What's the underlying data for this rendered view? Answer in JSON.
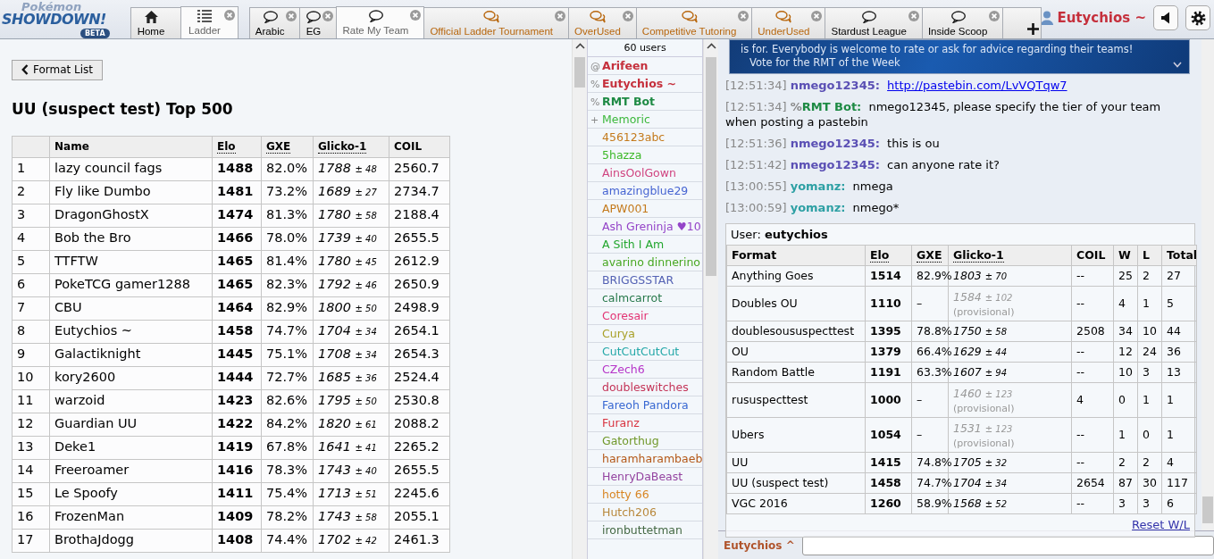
{
  "logo": {
    "top": "Pokémon",
    "main": "SHOWDOWN!",
    "badge": "BETA"
  },
  "page_tabs": [
    {
      "label": "Home",
      "kind": "home",
      "selected": false,
      "closable": false
    },
    {
      "label": "Ladder",
      "kind": "ladder",
      "selected": true,
      "closable": true
    }
  ],
  "room_tabs": [
    {
      "label": "Arabic",
      "official": false,
      "selected": false
    },
    {
      "label": "EG",
      "official": false,
      "selected": false
    },
    {
      "label": "Rate My Team",
      "official": false,
      "selected": true
    },
    {
      "label": "Official Ladder Tournament",
      "official": true,
      "selected": false
    },
    {
      "label": "OverUsed",
      "official": true,
      "selected": false
    },
    {
      "label": "Competitive Tutoring",
      "official": true,
      "selected": false
    },
    {
      "label": "UnderUsed",
      "official": true,
      "selected": false
    },
    {
      "label": "Stardust League",
      "official": false,
      "selected": false
    },
    {
      "label": "Inside Scoop",
      "official": false,
      "selected": false
    }
  ],
  "account": {
    "name": "Eutychios ~"
  },
  "ladder": {
    "back_button": "Format List",
    "title": "UU (suspect test) Top 500",
    "columns": [
      "Name",
      "Elo",
      "GXE",
      "Glicko-1",
      "COIL"
    ],
    "rows": [
      {
        "rank": "1",
        "name": "lazy council fags",
        "elo": "1488",
        "gxe": "82.0%",
        "glicko": "1788",
        "deviation": "± 48",
        "coil": "2560.7"
      },
      {
        "rank": "2",
        "name": "Fly like Dumbo",
        "elo": "1481",
        "gxe": "73.2%",
        "glicko": "1689",
        "deviation": "± 27",
        "coil": "2734.7"
      },
      {
        "rank": "3",
        "name": "DragonGhostX",
        "elo": "1474",
        "gxe": "81.3%",
        "glicko": "1780",
        "deviation": "± 58",
        "coil": "2188.4"
      },
      {
        "rank": "4",
        "name": "Bob the Bro",
        "elo": "1466",
        "gxe": "78.0%",
        "glicko": "1739",
        "deviation": "± 40",
        "coil": "2655.5"
      },
      {
        "rank": "5",
        "name": "TTFTW",
        "elo": "1465",
        "gxe": "81.4%",
        "glicko": "1780",
        "deviation": "± 45",
        "coil": "2612.9"
      },
      {
        "rank": "6",
        "name": "PokeTCG gamer1288",
        "elo": "1465",
        "gxe": "82.3%",
        "glicko": "1792",
        "deviation": "± 46",
        "coil": "2650.9"
      },
      {
        "rank": "7",
        "name": "CBU",
        "elo": "1464",
        "gxe": "82.9%",
        "glicko": "1800",
        "deviation": "± 50",
        "coil": "2498.9"
      },
      {
        "rank": "8",
        "name": "Eutychios ~",
        "elo": "1458",
        "gxe": "74.7%",
        "glicko": "1704",
        "deviation": "± 34",
        "coil": "2654.1"
      },
      {
        "rank": "9",
        "name": "Galactiknight",
        "elo": "1445",
        "gxe": "75.1%",
        "glicko": "1708",
        "deviation": "± 34",
        "coil": "2654.3"
      },
      {
        "rank": "10",
        "name": "kory2600",
        "elo": "1444",
        "gxe": "72.7%",
        "glicko": "1685",
        "deviation": "± 36",
        "coil": "2524.4"
      },
      {
        "rank": "11",
        "name": "warzoid",
        "elo": "1423",
        "gxe": "82.6%",
        "glicko": "1795",
        "deviation": "± 50",
        "coil": "2530.8"
      },
      {
        "rank": "12",
        "name": "Guardian UU",
        "elo": "1422",
        "gxe": "84.2%",
        "glicko": "1820",
        "deviation": "± 61",
        "coil": "2088.2"
      },
      {
        "rank": "13",
        "name": "Deke1",
        "elo": "1419",
        "gxe": "67.8%",
        "glicko": "1641",
        "deviation": "± 41",
        "coil": "2265.2"
      },
      {
        "rank": "14",
        "name": "Freeroamer",
        "elo": "1416",
        "gxe": "78.3%",
        "glicko": "1743",
        "deviation": "± 40",
        "coil": "2655.5"
      },
      {
        "rank": "15",
        "name": "Le Spoofy",
        "elo": "1411",
        "gxe": "75.4%",
        "glicko": "1713",
        "deviation": "± 51",
        "coil": "2245.6"
      },
      {
        "rank": "16",
        "name": "FrozenMan",
        "elo": "1409",
        "gxe": "78.2%",
        "glicko": "1743",
        "deviation": "± 58",
        "coil": "2055.1"
      },
      {
        "rank": "17",
        "name": "BrothaJdogg",
        "elo": "1408",
        "gxe": "74.4%",
        "glicko": "1702",
        "deviation": "± 42",
        "coil": "2461.3"
      }
    ]
  },
  "userlist": {
    "count": "60 users",
    "users": [
      {
        "rank": "@",
        "name": "Arifeen",
        "staff": true,
        "color": "#c5303c"
      },
      {
        "rank": "%",
        "name": "Eutychios ~",
        "staff": true,
        "color": "#c5303c"
      },
      {
        "rank": "%",
        "name": "RMT Bot",
        "staff": true,
        "color": "#1e8a44"
      },
      {
        "rank": "+",
        "name": "Memoric",
        "staff": false,
        "color": "#3cb83c"
      },
      {
        "name": "456123abc",
        "staff": false,
        "color": "#c47a1c"
      },
      {
        "name": "5hazza",
        "staff": false,
        "color": "#3cb828"
      },
      {
        "name": "AinsOolGown",
        "staff": false,
        "color": "#d04480"
      },
      {
        "name": "amazingblue29",
        "staff": false,
        "color": "#4664d2"
      },
      {
        "name": "APW001",
        "staff": false,
        "color": "#c47a1c"
      },
      {
        "name": "Ash Greninja ♥10",
        "staff": false,
        "color": "#9444c8"
      },
      {
        "name": "A Sith I Am",
        "staff": false,
        "color": "#22a62e"
      },
      {
        "name": "avarino dinnerino",
        "staff": false,
        "color": "#48a822"
      },
      {
        "name": "BRIGGSSTAR",
        "staff": false,
        "color": "#5462b4"
      },
      {
        "name": "calmcarrot",
        "staff": false,
        "color": "#26784a"
      },
      {
        "name": "Coresair",
        "staff": false,
        "color": "#e23474"
      },
      {
        "name": "Curya",
        "staff": false,
        "color": "#a8a028"
      },
      {
        "name": "CutCutCutCut",
        "staff": false,
        "color": "#24a8a8"
      },
      {
        "name": "CZech6",
        "staff": false,
        "color": "#b634c8"
      },
      {
        "name": "doubleswitches",
        "staff": false,
        "color": "#c43458"
      },
      {
        "name": "Fareoh Pandora",
        "staff": false,
        "color": "#3868d2"
      },
      {
        "name": "Furanz",
        "staff": false,
        "color": "#d83440"
      },
      {
        "name": "Gatorthug",
        "staff": false,
        "color": "#70982a"
      },
      {
        "name": "haramharambaeb",
        "staff": false,
        "color": "#b45818"
      },
      {
        "name": "HenryDaBeast",
        "staff": false,
        "color": "#9444a0"
      },
      {
        "name": "hotty 66",
        "staff": false,
        "color": "#d88624"
      },
      {
        "name": "Hutch206",
        "staff": false,
        "color": "#b8883c"
      },
      {
        "name": "ironbuttetman",
        "staff": false,
        "color": "#466a46"
      }
    ]
  },
  "chat": {
    "banner": {
      "text": "is for. Everybody is welcome to rate or ask for advice regarding their teams!",
      "bullet": "Vote for the RMT of the Week"
    },
    "messages": [
      {
        "time": "[12:51:34]",
        "user": "nmego12345:",
        "color": "#5a4fb4",
        "kind": "link",
        "text": "http://pastebin.com/LvVQTqw7"
      },
      {
        "time": "[12:51:34]",
        "rank": "%",
        "user": "RMT Bot:",
        "color": "#1e8a44",
        "kind": "text",
        "text": "nmego12345, please specify the tier of your team when posting a pastebin"
      },
      {
        "time": "[12:51:36]",
        "user": "nmego12345:",
        "color": "#5a4fb4",
        "kind": "text",
        "text": "this is ou"
      },
      {
        "time": "[12:51:42]",
        "user": "nmego12345:",
        "color": "#5a4fb4",
        "kind": "text",
        "text": "can anyone rate it?"
      },
      {
        "time": "[13:00:55]",
        "user": "yomanz:",
        "color": "#2ea0a4",
        "kind": "text",
        "text": "nmega"
      },
      {
        "time": "[13:00:59]",
        "user": "yomanz:",
        "color": "#2ea0a4",
        "kind": "text",
        "text": "nmego*"
      }
    ],
    "user_stats": {
      "heading": "User: **eutychios**",
      "columns": [
        "Format",
        "Elo",
        "GXE",
        "Glicko-1",
        "COIL",
        "W",
        "L",
        "Total"
      ],
      "rows": [
        {
          "format": "Anything Goes",
          "elo": "1514",
          "gxe": "82.9%",
          "glicko": "1803",
          "deviation": "± 70",
          "provisional": false,
          "coil": "--",
          "w": "25",
          "l": "2",
          "total": "27"
        },
        {
          "format": "Doubles OU",
          "elo": "1110",
          "gxe": "–",
          "glicko": "1584",
          "deviation": "± 102",
          "provisional": true,
          "note": "(provisional)",
          "coil": "--",
          "w": "4",
          "l": "1",
          "total": "5"
        },
        {
          "format": "doublesoususpecttest",
          "elo": "1395",
          "gxe": "78.8%",
          "glicko": "1750",
          "deviation": "± 58",
          "provisional": false,
          "coil": "2508",
          "w": "34",
          "l": "10",
          "total": "44"
        },
        {
          "format": "OU",
          "elo": "1379",
          "gxe": "66.4%",
          "glicko": "1629",
          "deviation": "± 44",
          "provisional": false,
          "coil": "--",
          "w": "12",
          "l": "24",
          "total": "36"
        },
        {
          "format": "Random Battle",
          "elo": "1191",
          "gxe": "63.3%",
          "glicko": "1607",
          "deviation": "± 94",
          "provisional": false,
          "coil": "--",
          "w": "10",
          "l": "3",
          "total": "13"
        },
        {
          "format": "rususpecttest",
          "elo": "1000",
          "gxe": "–",
          "glicko": "1460",
          "deviation": "± 123",
          "provisional": true,
          "note": "(provisional)",
          "coil": "4",
          "w": "0",
          "l": "1",
          "total": "1"
        },
        {
          "format": "Ubers",
          "elo": "1054",
          "gxe": "–",
          "glicko": "1531",
          "deviation": "± 123",
          "provisional": true,
          "note": "(provisional)",
          "coil": "--",
          "w": "1",
          "l": "0",
          "total": "1"
        },
        {
          "format": "UU",
          "elo": "1415",
          "gxe": "74.8%",
          "glicko": "1705",
          "deviation": "± 32",
          "provisional": false,
          "coil": "--",
          "w": "2",
          "l": "2",
          "total": "4"
        },
        {
          "format": "UU (suspect test)",
          "elo": "1458",
          "gxe": "74.7%",
          "glicko": "1704",
          "deviation": "± 34",
          "provisional": false,
          "coil": "2654",
          "w": "87",
          "l": "30",
          "total": "117"
        },
        {
          "format": "VGC 2016",
          "elo": "1260",
          "gxe": "58.9%",
          "glicko": "1568",
          "deviation": "± 52",
          "provisional": false,
          "coil": "--",
          "w": "3",
          "l": "3",
          "total": "6"
        }
      ],
      "reset_link": "Reset W/L"
    },
    "input_label": "Eutychios ^"
  }
}
